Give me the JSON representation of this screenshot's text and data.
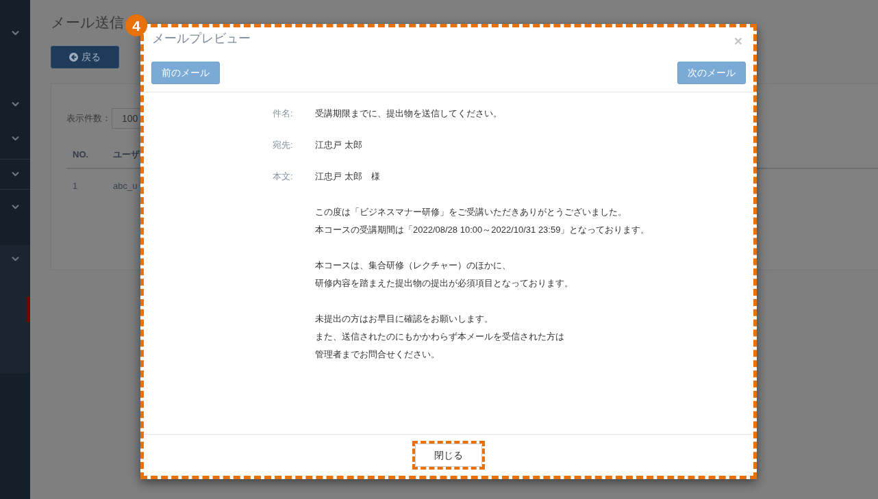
{
  "sidebar": {
    "groups": [
      {
        "selected": false
      },
      {
        "selected": false
      },
      {
        "selected": false
      },
      {
        "selected": false
      },
      {
        "selected": false
      },
      {
        "selected": true
      }
    ]
  },
  "page": {
    "title": "メール送信",
    "back_button": "戻る",
    "page_size": {
      "label": "表示件数：",
      "value": "100"
    },
    "table": {
      "columns": [
        "NO.",
        "ユーザ"
      ],
      "rows": [
        [
          "1",
          "abc_u"
        ]
      ]
    }
  },
  "annotation": {
    "step": "4"
  },
  "dialog": {
    "highlighted": true,
    "title": "メールプレビュー",
    "close": "×",
    "prev_button": "前のメール",
    "next_button": "次のメール",
    "fields": [
      {
        "label": "件名:",
        "paragraphs": [
          [
            "受講期限までに、提出物を送信してください。"
          ]
        ]
      },
      {
        "label": "宛先:",
        "paragraphs": [
          [
            "江忠戸 太郎"
          ]
        ]
      },
      {
        "label": "本文:",
        "paragraphs": [
          [
            "江忠戸 太郎　様"
          ],
          [
            "この度は「ビジネスマナー研修」をご受講いただきありがとうございました。",
            "本コースの受講期間は「2022/08/28 10:00～2022/10/31 23:59」となっております。"
          ],
          [
            "本コースは、集合研修（レクチャー）のほかに、",
            "研修内容を踏まえた提出物の提出が必須項目となっております。"
          ],
          [
            "未提出の方はお早目に確認をお願いします。",
            "また、送信されたのにもかかわらず本メールを受信された方は",
            "管理者までお問合せください。"
          ]
        ]
      }
    ],
    "close_button": {
      "label": "閉じる",
      "highlighted": true
    }
  }
}
